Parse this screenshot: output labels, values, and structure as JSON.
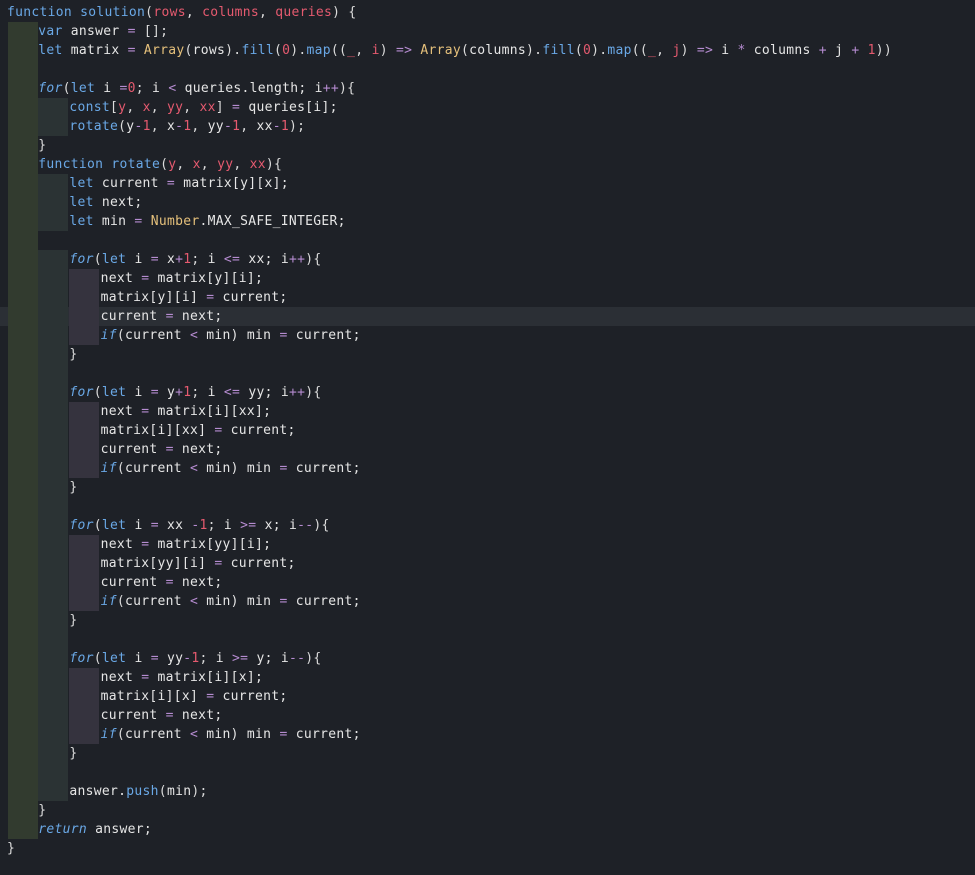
{
  "editor": {
    "theme_colors": {
      "background": "#1e2127",
      "keyword": "#6aa8e6",
      "parameter": "#e55a6f",
      "class": "#e5c07b",
      "number": "#e55a6f",
      "operator": "#b68cd1",
      "text": "#e6e6e6",
      "current_line": "#2b2f35"
    },
    "current_line_index": 16,
    "lines": [
      {
        "indent": 0,
        "tokens": [
          [
            "kw",
            "function"
          ],
          [
            "id",
            " "
          ],
          [
            "fn",
            "solution"
          ],
          [
            "pun",
            "("
          ],
          [
            "prm",
            "rows"
          ],
          [
            "pun",
            ", "
          ],
          [
            "prm",
            "columns"
          ],
          [
            "pun",
            ", "
          ],
          [
            "prm",
            "queries"
          ],
          [
            "pun",
            ") {"
          ]
        ]
      },
      {
        "indent": 1,
        "tokens": [
          [
            "kw",
            "var"
          ],
          [
            "id",
            " answer "
          ],
          [
            "op",
            "="
          ],
          [
            "pun",
            " [];"
          ]
        ]
      },
      {
        "indent": 1,
        "tokens": [
          [
            "kw",
            "let"
          ],
          [
            "id",
            " matrix "
          ],
          [
            "op",
            "="
          ],
          [
            "id",
            " "
          ],
          [
            "cls",
            "Array"
          ],
          [
            "pun",
            "("
          ],
          [
            "id",
            "rows"
          ],
          [
            "pun",
            ")."
          ],
          [
            "mth",
            "fill"
          ],
          [
            "pun",
            "("
          ],
          [
            "num",
            "0"
          ],
          [
            "pun",
            ")."
          ],
          [
            "mth",
            "map"
          ],
          [
            "pun",
            "(("
          ],
          [
            "prm",
            "_"
          ],
          [
            "pun",
            ", "
          ],
          [
            "prm",
            "i"
          ],
          [
            "pun",
            ") "
          ],
          [
            "op",
            "=>"
          ],
          [
            "id",
            " "
          ],
          [
            "cls",
            "Array"
          ],
          [
            "pun",
            "("
          ],
          [
            "id",
            "columns"
          ],
          [
            "pun",
            ")."
          ],
          [
            "mth",
            "fill"
          ],
          [
            "pun",
            "("
          ],
          [
            "num",
            "0"
          ],
          [
            "pun",
            ")."
          ],
          [
            "mth",
            "map"
          ],
          [
            "pun",
            "(("
          ],
          [
            "prm",
            "_"
          ],
          [
            "pun",
            ", "
          ],
          [
            "prm",
            "j"
          ],
          [
            "pun",
            ") "
          ],
          [
            "op",
            "=>"
          ],
          [
            "id",
            " i "
          ],
          [
            "op",
            "*"
          ],
          [
            "id",
            " columns "
          ],
          [
            "op",
            "+"
          ],
          [
            "id",
            " j "
          ],
          [
            "op",
            "+"
          ],
          [
            "id",
            " "
          ],
          [
            "num",
            "1"
          ],
          [
            "pun",
            "))"
          ]
        ]
      },
      {
        "indent": 1,
        "tokens": []
      },
      {
        "indent": 1,
        "tokens": [
          [
            "kwi",
            "for"
          ],
          [
            "pun",
            "("
          ],
          [
            "kw",
            "let"
          ],
          [
            "id",
            " i "
          ],
          [
            "op",
            "="
          ],
          [
            "num",
            "0"
          ],
          [
            "pun",
            "; "
          ],
          [
            "id",
            "i "
          ],
          [
            "op",
            "<"
          ],
          [
            "id",
            " queries.length; i"
          ],
          [
            "op",
            "++"
          ],
          [
            "pun",
            "){"
          ]
        ]
      },
      {
        "indent": 2,
        "tokens": [
          [
            "kw",
            "const"
          ],
          [
            "pun",
            "["
          ],
          [
            "prm",
            "y"
          ],
          [
            "pun",
            ", "
          ],
          [
            "prm",
            "x"
          ],
          [
            "pun",
            ", "
          ],
          [
            "prm",
            "yy"
          ],
          [
            "pun",
            ", "
          ],
          [
            "prm",
            "xx"
          ],
          [
            "pun",
            "] "
          ],
          [
            "op",
            "="
          ],
          [
            "id",
            " queries[i];"
          ]
        ]
      },
      {
        "indent": 2,
        "tokens": [
          [
            "mth",
            "rotate"
          ],
          [
            "pun",
            "("
          ],
          [
            "id",
            "y"
          ],
          [
            "op",
            "-"
          ],
          [
            "num",
            "1"
          ],
          [
            "pun",
            ", "
          ],
          [
            "id",
            "x"
          ],
          [
            "op",
            "-"
          ],
          [
            "num",
            "1"
          ],
          [
            "pun",
            ", "
          ],
          [
            "id",
            "yy"
          ],
          [
            "op",
            "-"
          ],
          [
            "num",
            "1"
          ],
          [
            "pun",
            ", "
          ],
          [
            "id",
            "xx"
          ],
          [
            "op",
            "-"
          ],
          [
            "num",
            "1"
          ],
          [
            "pun",
            ");"
          ]
        ]
      },
      {
        "indent": 1,
        "tokens": [
          [
            "pun",
            "}"
          ]
        ]
      },
      {
        "indent": 1,
        "tokens": [
          [
            "kw",
            "function"
          ],
          [
            "id",
            " "
          ],
          [
            "fn",
            "rotate"
          ],
          [
            "pun",
            "("
          ],
          [
            "prm",
            "y"
          ],
          [
            "pun",
            ", "
          ],
          [
            "prm",
            "x"
          ],
          [
            "pun",
            ", "
          ],
          [
            "prm",
            "yy"
          ],
          [
            "pun",
            ", "
          ],
          [
            "prm",
            "xx"
          ],
          [
            "pun",
            "){"
          ]
        ]
      },
      {
        "indent": 2,
        "tokens": [
          [
            "kw",
            "let"
          ],
          [
            "id",
            " current "
          ],
          [
            "op",
            "="
          ],
          [
            "id",
            " matrix[y][x];"
          ]
        ]
      },
      {
        "indent": 2,
        "tokens": [
          [
            "kw",
            "let"
          ],
          [
            "id",
            " next;"
          ]
        ]
      },
      {
        "indent": 2,
        "tokens": [
          [
            "kw",
            "let"
          ],
          [
            "id",
            " min "
          ],
          [
            "op",
            "="
          ],
          [
            "id",
            " "
          ],
          [
            "cls",
            "Number"
          ],
          [
            "id",
            ".MAX_SAFE_INTEGER;"
          ]
        ]
      },
      {
        "indent": 1,
        "tokens": []
      },
      {
        "indent": 2,
        "tokens": [
          [
            "kwi",
            "for"
          ],
          [
            "pun",
            "("
          ],
          [
            "kw",
            "let"
          ],
          [
            "id",
            " i "
          ],
          [
            "op",
            "="
          ],
          [
            "id",
            " x"
          ],
          [
            "op",
            "+"
          ],
          [
            "num",
            "1"
          ],
          [
            "pun",
            "; "
          ],
          [
            "id",
            "i "
          ],
          [
            "op",
            "<="
          ],
          [
            "id",
            " xx; i"
          ],
          [
            "op",
            "++"
          ],
          [
            "pun",
            "){"
          ]
        ]
      },
      {
        "indent": 3,
        "tokens": [
          [
            "id",
            "next "
          ],
          [
            "op",
            "="
          ],
          [
            "id",
            " matrix[y][i];"
          ]
        ]
      },
      {
        "indent": 3,
        "tokens": [
          [
            "id",
            "matrix[y][i] "
          ],
          [
            "op",
            "="
          ],
          [
            "id",
            " current;"
          ]
        ]
      },
      {
        "indent": 3,
        "tokens": [
          [
            "id",
            "current "
          ],
          [
            "op",
            "="
          ],
          [
            "id",
            " next;"
          ]
        ]
      },
      {
        "indent": 3,
        "tokens": [
          [
            "kwi",
            "if"
          ],
          [
            "pun",
            "("
          ],
          [
            "id",
            "current "
          ],
          [
            "op",
            "<"
          ],
          [
            "id",
            " min) min "
          ],
          [
            "op",
            "="
          ],
          [
            "id",
            " current;"
          ]
        ]
      },
      {
        "indent": 2,
        "tokens": [
          [
            "pun",
            "}"
          ]
        ]
      },
      {
        "indent": 2,
        "tokens": []
      },
      {
        "indent": 2,
        "tokens": [
          [
            "kwi",
            "for"
          ],
          [
            "pun",
            "("
          ],
          [
            "kw",
            "let"
          ],
          [
            "id",
            " i "
          ],
          [
            "op",
            "="
          ],
          [
            "id",
            " y"
          ],
          [
            "op",
            "+"
          ],
          [
            "num",
            "1"
          ],
          [
            "pun",
            "; "
          ],
          [
            "id",
            "i "
          ],
          [
            "op",
            "<="
          ],
          [
            "id",
            " yy; i"
          ],
          [
            "op",
            "++"
          ],
          [
            "pun",
            "){"
          ]
        ]
      },
      {
        "indent": 3,
        "tokens": [
          [
            "id",
            "next "
          ],
          [
            "op",
            "="
          ],
          [
            "id",
            " matrix[i][xx];"
          ]
        ]
      },
      {
        "indent": 3,
        "tokens": [
          [
            "id",
            "matrix[i][xx] "
          ],
          [
            "op",
            "="
          ],
          [
            "id",
            " current;"
          ]
        ]
      },
      {
        "indent": 3,
        "tokens": [
          [
            "id",
            "current "
          ],
          [
            "op",
            "="
          ],
          [
            "id",
            " next;"
          ]
        ]
      },
      {
        "indent": 3,
        "tokens": [
          [
            "kwi",
            "if"
          ],
          [
            "pun",
            "("
          ],
          [
            "id",
            "current "
          ],
          [
            "op",
            "<"
          ],
          [
            "id",
            " min) min "
          ],
          [
            "op",
            "="
          ],
          [
            "id",
            " current;"
          ]
        ]
      },
      {
        "indent": 2,
        "tokens": [
          [
            "pun",
            "}"
          ]
        ]
      },
      {
        "indent": 2,
        "tokens": []
      },
      {
        "indent": 2,
        "tokens": [
          [
            "kwi",
            "for"
          ],
          [
            "pun",
            "("
          ],
          [
            "kw",
            "let"
          ],
          [
            "id",
            " i "
          ],
          [
            "op",
            "="
          ],
          [
            "id",
            " xx "
          ],
          [
            "op",
            "-"
          ],
          [
            "num",
            "1"
          ],
          [
            "pun",
            "; "
          ],
          [
            "id",
            "i "
          ],
          [
            "op",
            ">="
          ],
          [
            "id",
            " x; i"
          ],
          [
            "op",
            "--"
          ],
          [
            "pun",
            "){"
          ]
        ]
      },
      {
        "indent": 3,
        "tokens": [
          [
            "id",
            "next "
          ],
          [
            "op",
            "="
          ],
          [
            "id",
            " matrix[yy][i];"
          ]
        ]
      },
      {
        "indent": 3,
        "tokens": [
          [
            "id",
            "matrix[yy][i] "
          ],
          [
            "op",
            "="
          ],
          [
            "id",
            " current;"
          ]
        ]
      },
      {
        "indent": 3,
        "tokens": [
          [
            "id",
            "current "
          ],
          [
            "op",
            "="
          ],
          [
            "id",
            " next;"
          ]
        ]
      },
      {
        "indent": 3,
        "tokens": [
          [
            "kwi",
            "if"
          ],
          [
            "pun",
            "("
          ],
          [
            "id",
            "current "
          ],
          [
            "op",
            "<"
          ],
          [
            "id",
            " min) min "
          ],
          [
            "op",
            "="
          ],
          [
            "id",
            " current;"
          ]
        ]
      },
      {
        "indent": 2,
        "tokens": [
          [
            "pun",
            "}"
          ]
        ]
      },
      {
        "indent": 2,
        "tokens": []
      },
      {
        "indent": 2,
        "tokens": [
          [
            "kwi",
            "for"
          ],
          [
            "pun",
            "("
          ],
          [
            "kw",
            "let"
          ],
          [
            "id",
            " i "
          ],
          [
            "op",
            "="
          ],
          [
            "id",
            " yy"
          ],
          [
            "op",
            "-"
          ],
          [
            "num",
            "1"
          ],
          [
            "pun",
            "; "
          ],
          [
            "id",
            "i "
          ],
          [
            "op",
            ">="
          ],
          [
            "id",
            " y; i"
          ],
          [
            "op",
            "--"
          ],
          [
            "pun",
            "){"
          ]
        ]
      },
      {
        "indent": 3,
        "tokens": [
          [
            "id",
            "next "
          ],
          [
            "op",
            "="
          ],
          [
            "id",
            " matrix[i][x];"
          ]
        ]
      },
      {
        "indent": 3,
        "tokens": [
          [
            "id",
            "matrix[i][x] "
          ],
          [
            "op",
            "="
          ],
          [
            "id",
            " current;"
          ]
        ]
      },
      {
        "indent": 3,
        "tokens": [
          [
            "id",
            "current "
          ],
          [
            "op",
            "="
          ],
          [
            "id",
            " next;"
          ]
        ]
      },
      {
        "indent": 3,
        "tokens": [
          [
            "kwi",
            "if"
          ],
          [
            "pun",
            "("
          ],
          [
            "id",
            "current "
          ],
          [
            "op",
            "<"
          ],
          [
            "id",
            " min) min "
          ],
          [
            "op",
            "="
          ],
          [
            "id",
            " current;"
          ]
        ]
      },
      {
        "indent": 2,
        "tokens": [
          [
            "pun",
            "}"
          ]
        ]
      },
      {
        "indent": 2,
        "tokens": []
      },
      {
        "indent": 2,
        "tokens": [
          [
            "id",
            "answer."
          ],
          [
            "mth",
            "push"
          ],
          [
            "pun",
            "("
          ],
          [
            "id",
            "min"
          ],
          [
            "pun",
            ");"
          ]
        ]
      },
      {
        "indent": 1,
        "tokens": [
          [
            "pun",
            "}"
          ]
        ]
      },
      {
        "indent": 1,
        "tokens": [
          [
            "kwi",
            "return"
          ],
          [
            "id",
            " answer;"
          ]
        ]
      },
      {
        "indent": 0,
        "tokens": [
          [
            "pun",
            "}"
          ]
        ]
      }
    ]
  }
}
